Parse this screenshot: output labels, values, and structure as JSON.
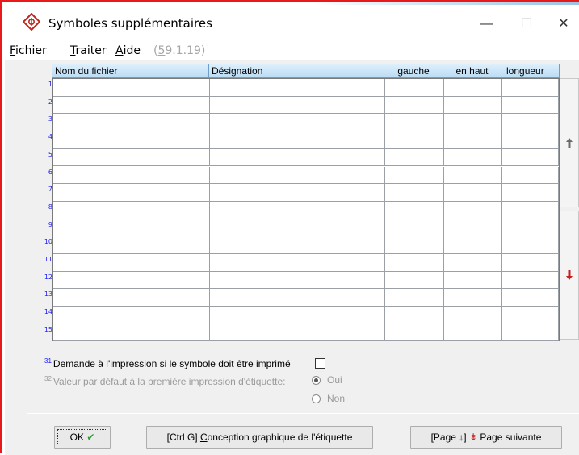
{
  "window": {
    "title": "Symboles supplémentaires",
    "minimize_glyph": "—",
    "maximize_glyph": "☐",
    "close_glyph": "✕",
    "app_icon": "diamond-logo-icon"
  },
  "menu": {
    "items": [
      {
        "accel": "F",
        "rest": "ichier"
      },
      {
        "accel": "T",
        "rest": "raiter"
      },
      {
        "accel": "A",
        "rest": "ide"
      }
    ],
    "version_prefix": "(",
    "version_accel": "5",
    "version_rest": "9.1.19)"
  },
  "grid": {
    "columns": [
      "Nom du fichier",
      "Désignation",
      "gauche",
      "en haut",
      "longueur"
    ],
    "row_numbers": [
      "1",
      "2",
      "3",
      "4",
      "5",
      "6",
      "7",
      "8",
      "9",
      "10",
      "11",
      "12",
      "13",
      "14",
      "15"
    ]
  },
  "options": {
    "question_num": "31",
    "question_text": "Demande à l'impression si le symbole doit être imprimé",
    "default_num": "32",
    "default_text": "Valeur par défaut à la première impression d'étiquette:",
    "radio_oui": "Oui",
    "radio_non": "Non",
    "radio_selected": "Oui"
  },
  "buttons": {
    "ok_label": "OK",
    "ok_check_glyph": "✔",
    "design_prefix": "[Ctrl G] ",
    "design_accel": "C",
    "design_rest": "onception graphique de l'étiquette",
    "next_prefix": "[Page ↓] ",
    "next_glyph": "⇟",
    "next_label": "Page suivante"
  },
  "scroll": {
    "up_icon": "arrow-up-icon",
    "down_icon": "arrow-down-icon"
  },
  "colors": {
    "frame_border": "#e8191a",
    "header_gradient_top": "#dff0fc",
    "header_gradient_bottom": "#b9dcf5",
    "row_number_blue": "#1a1aff",
    "down_arrow_red": "#c81e1e",
    "check_green": "#2e9a2e"
  }
}
